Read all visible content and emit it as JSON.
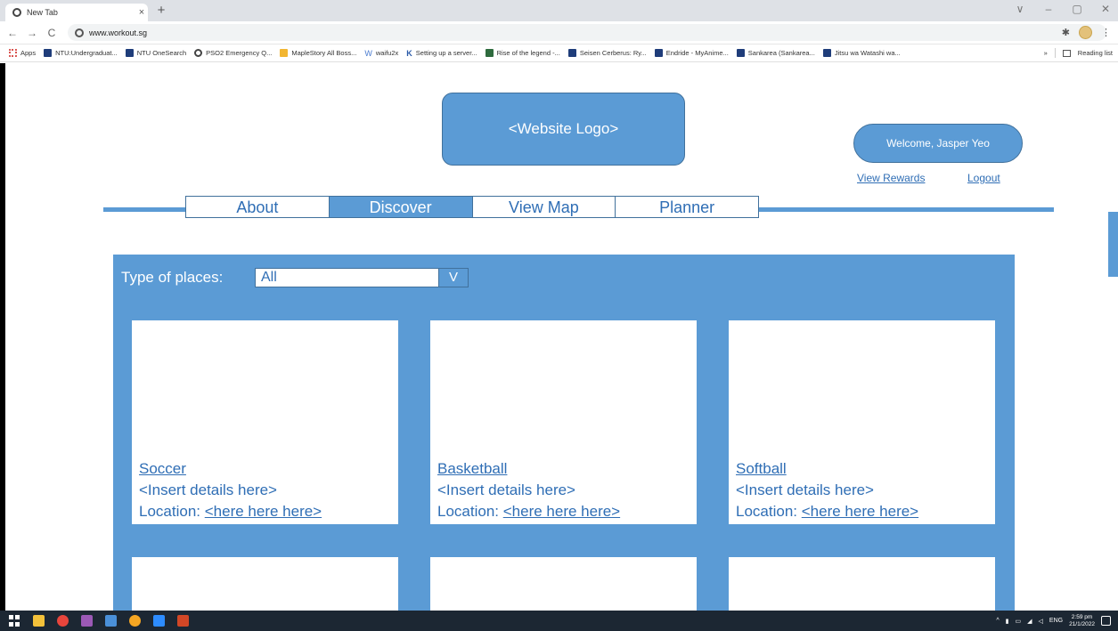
{
  "browser": {
    "tab_title": "New Tab",
    "tab_close": "×",
    "new_tab": "+",
    "url": "www.workout.sg",
    "window_controls": [
      "∨",
      "–",
      "▢",
      "✕"
    ]
  },
  "bookmarks": {
    "items": [
      {
        "label": "Apps",
        "icon": "apps-grid-icon"
      },
      {
        "label": "NTU:Undergraduat...",
        "icon": "ntu-icon"
      },
      {
        "label": "NTU OneSearch",
        "icon": "ntu-icon"
      },
      {
        "label": "PSO2 Emergency Q...",
        "icon": "globe-icon"
      },
      {
        "label": "MapleStory All Boss...",
        "icon": "maplestory-icon"
      },
      {
        "label": "waifu2x",
        "icon": "waifu2x-icon"
      },
      {
        "label": "Setting up a server...",
        "icon": "k-icon"
      },
      {
        "label": "Rise of the legend -...",
        "icon": "image-icon"
      },
      {
        "label": "Seisen Cerberus: Ry...",
        "icon": "mal-icon"
      },
      {
        "label": "Endride - MyAnime...",
        "icon": "mal-icon"
      },
      {
        "label": "Sankarea (Sankarea...",
        "icon": "mal-icon"
      },
      {
        "label": "Jitsu wa Watashi wa...",
        "icon": "mal-icon"
      }
    ],
    "overflow": "»",
    "reading_list": "Reading list"
  },
  "header": {
    "logo_text": "<Website Logo>",
    "welcome": "Welcome, Jasper Yeo",
    "view_rewards": "View Rewards",
    "logout": "Logout"
  },
  "nav": {
    "tabs": [
      "About",
      "Discover",
      "View Map",
      "Planner"
    ],
    "active": "Discover"
  },
  "filter": {
    "label": "Type of places:",
    "value": "All",
    "button": "V"
  },
  "cards": [
    {
      "title": "Soccer",
      "details": "<Insert details here>",
      "location_label": "Location: ",
      "location_link": "<here here here>"
    },
    {
      "title": "Basketball",
      "details": "<Insert details here>",
      "location_label": "Location: ",
      "location_link": "<here here here>"
    },
    {
      "title": "Softball",
      "details": "<Insert details here>",
      "location_label": "Location: ",
      "location_link": "<here here here>"
    }
  ],
  "taskbar": {
    "tray_lang": "ENG",
    "time": "2:59 pm",
    "date": "21/1/2022",
    "apps": [
      "windows-start-icon",
      "file-explorer-icon",
      "chrome-icon",
      "snipping-tool-icon",
      "app-icon",
      "chrome-icon",
      "zoom-icon",
      "powerpoint-icon"
    ]
  },
  "colors": {
    "accent": "#5b9bd5",
    "accent_border": "#41719c",
    "link": "#2f6eb5"
  }
}
